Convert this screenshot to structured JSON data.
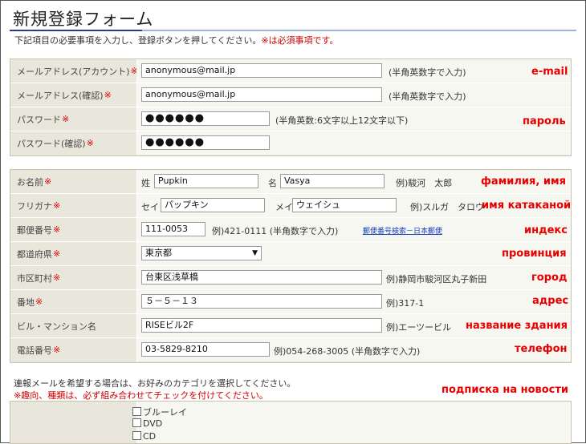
{
  "page": {
    "title": "新規登録フォーム",
    "intro": "下記項目の必要事項を入力し、登録ボタンを押してください。",
    "intro_required": "※は必須事項です。",
    "required_mark": "※"
  },
  "account": {
    "email_label": "メールアドレス(アカウント)",
    "email_value": "anonymous@mail.jp",
    "email_hint": "(半角英数字で入力)",
    "email_confirm_label": "メールアドレス(確認)",
    "email_confirm_value": "anonymous@mail.jp",
    "email_confirm_hint": "(半角英数字で入力)",
    "password_label": "パスワード",
    "password_value": "●●●●●●",
    "password_hint": "(半角英数:6文字以上12文字以下)",
    "password_confirm_label": "パスワード(確認)",
    "password_confirm_value": "●●●●●●"
  },
  "personal": {
    "name_label": "お名前",
    "sei_label": "姓",
    "sei_value": "Pupkin",
    "mei_label": "名",
    "mei_value": "Vasya",
    "name_example": "例)駿河　太郎",
    "kana_label": "フリガナ",
    "kana_sei_label": "セイ",
    "kana_sei_value": "パップキン",
    "kana_mei_label": "メイ",
    "kana_mei_value": "ウェイシュ",
    "kana_example": "例)スルガ　タロウ",
    "zip_label": "郵便番号",
    "zip_value": "111-0053",
    "zip_example": "例)421-0111 (半角数字で入力)",
    "zip_link": "郵便番号検索－日本郵便",
    "pref_label": "都道府県",
    "pref_value": "東京都",
    "city_label": "市区町村",
    "city_value": "台東区浅草橋",
    "city_example": "例)静岡市駿河区丸子新田",
    "address_label": "番地",
    "address_value": "５－５－１３",
    "address_example": "例)317-1",
    "building_label": "ビル・マンション名",
    "building_value": "RISEビル2F",
    "building_example": "例)エーツービル",
    "phone_label": "電話番号",
    "phone_value": "03-5829-8210",
    "phone_example": "例)054-268-3005 (半角数字で入力)"
  },
  "subscription": {
    "text": "連報メールを希望する場合は、お好みのカテゴリを選択してください。",
    "warning": "※趣向、種類は、必ず組み合わせてチェックを付けてください。",
    "categories": [
      "ブルーレイ",
      "DVD",
      "CD"
    ]
  },
  "annotations": {
    "email": "e-mail",
    "password": "пароль",
    "name": "фамилия, имя",
    "kana": "имя катаканой",
    "zip": "индекс",
    "pref": "провинция",
    "city": "город",
    "address": "адрес",
    "building": "название здания",
    "phone": "телефон",
    "subscription": "подписка на новости"
  },
  "colors": {
    "annotation": "#e60000",
    "required": "#cc0000",
    "label_bg": "#e9e7dc",
    "value_bg": "#f7f7f2",
    "title_rule": "#2a3a8c"
  }
}
